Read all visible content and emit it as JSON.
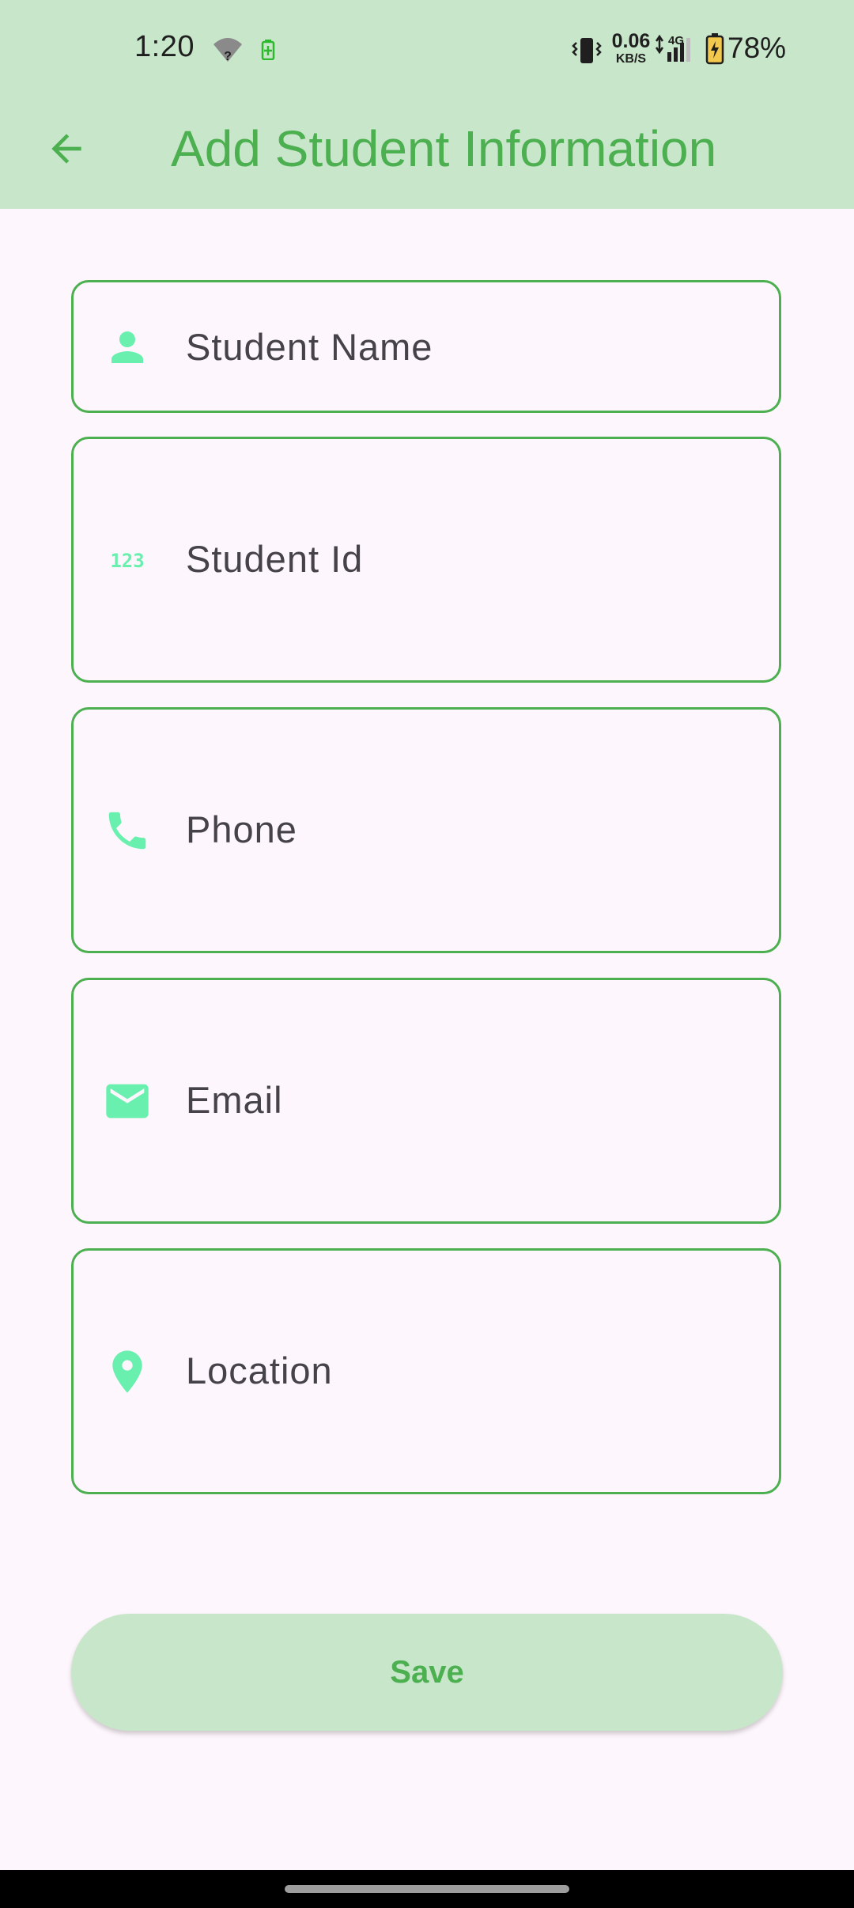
{
  "status_bar": {
    "time": "1:20",
    "net_speed_value": "0.06",
    "net_speed_unit": "KB/S",
    "network_type": "4G",
    "battery": "78%",
    "icons": [
      "wifi-icon",
      "battery-saver-icon",
      "vibrate-icon",
      "data-arrows-icon",
      "signal-icon",
      "battery-charging-icon"
    ]
  },
  "app_bar": {
    "title": "Add Student Information",
    "back_icon": "arrow-back-icon"
  },
  "form": {
    "fields": [
      {
        "label": "Student Name",
        "icon": "person-icon"
      },
      {
        "label": "Student Id",
        "icon": "numbers-icon"
      },
      {
        "label": "Phone",
        "icon": "phone-icon"
      },
      {
        "label": "Email",
        "icon": "email-icon"
      },
      {
        "label": "Location",
        "icon": "location-pin-icon"
      }
    ],
    "save_label": "Save"
  },
  "colors": {
    "app_bar_bg": "#C8E6C9",
    "accent": "#4CAF50",
    "icon_tint": "#69F0AE",
    "background": "#FDF6FC",
    "label_text": "#45424A"
  }
}
